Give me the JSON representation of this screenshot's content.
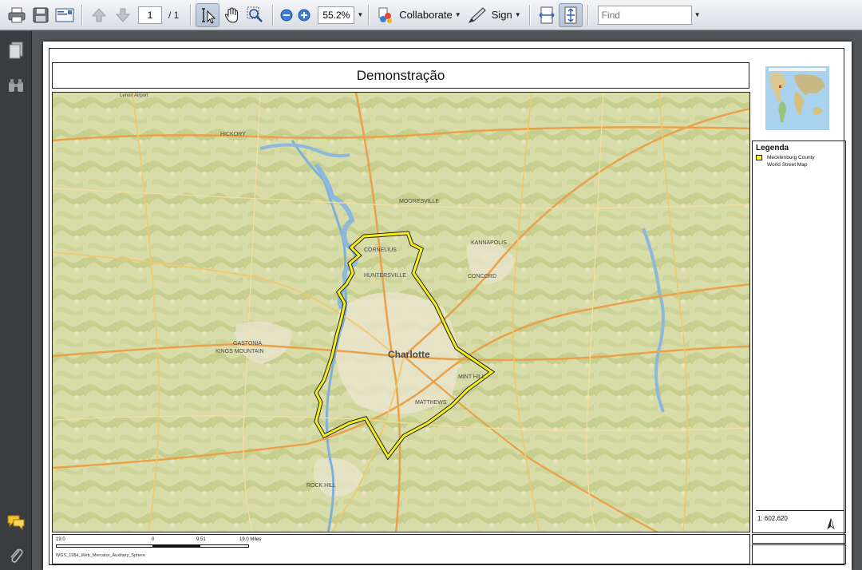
{
  "toolbar": {
    "page_current": "1",
    "page_total": "/ 1",
    "zoom": "55.2%",
    "collaborate_label": "Collaborate",
    "sign_label": "Sign",
    "find_placeholder": "Find"
  },
  "document": {
    "title": "Demonstração",
    "legend": {
      "title": "Legenda",
      "items": [
        "Mecklenburg County",
        "World Street Map"
      ],
      "scale": "1: 602,620"
    },
    "scalebar": {
      "labels": [
        "19.0",
        "0",
        "9.51",
        "19.0 Miles"
      ],
      "projection": "WGS_1984_Web_Mercator_Auxiliary_Sphere"
    },
    "map_labels": {
      "city": "Charlotte",
      "towns": [
        "HUNTERSVILLE",
        "CORNELIUS",
        "MOORESVILLE",
        "KANNAPOLIS",
        "CONCORD",
        "GASTONIA",
        "KINGS MOUNTAIN",
        "MATTHEWS",
        "MINT HILL",
        "ROCK HILL",
        "HICKORY",
        "Lenoir Airport"
      ]
    }
  }
}
